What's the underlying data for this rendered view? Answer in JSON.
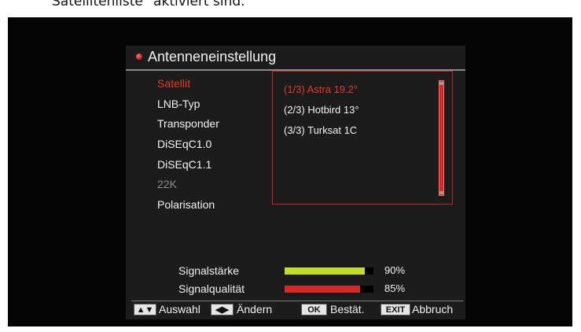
{
  "caption": "Satellitenliste\" aktiviert sind.",
  "window": {
    "title": "Antenneneinstellung"
  },
  "menu": {
    "items": [
      {
        "label": "Satellit",
        "state": "active"
      },
      {
        "label": "LNB-Typ",
        "state": "normal"
      },
      {
        "label": "Transponder",
        "state": "normal"
      },
      {
        "label": "DiSEqC1.0",
        "state": "normal"
      },
      {
        "label": "DiSEqC1.1",
        "state": "normal"
      },
      {
        "label": "22K",
        "state": "disabled"
      },
      {
        "label": "Polarisation",
        "state": "normal"
      }
    ]
  },
  "satellite_list": {
    "items": [
      {
        "label": "(1/3) Astra 19.2°",
        "selected": true
      },
      {
        "label": "(2/3) Hotbird 13°",
        "selected": false
      },
      {
        "label": "(3/3) Turksat 1C",
        "selected": false
      }
    ]
  },
  "signal": {
    "strength": {
      "label": "Signalstärke",
      "value": "90%",
      "level": 0.9,
      "color": "#c6dc2c"
    },
    "quality": {
      "label": "Signalqualität",
      "value": "85%",
      "level": 0.85,
      "color": "#d42a2a"
    }
  },
  "help": {
    "select_key": "▲▼",
    "select_label": "Auswahl",
    "change_key": "◀▶",
    "change_label": "Ändern",
    "ok_key": "OK",
    "ok_label": "Bestät.",
    "exit_key": "EXIT",
    "exit_label": "Abbruch"
  },
  "colors": {
    "accent": "#e23a2a",
    "osd_background": "#1c1c1c",
    "screen_background": "#040404"
  },
  "icons": {
    "title": "red-dot-icon"
  }
}
